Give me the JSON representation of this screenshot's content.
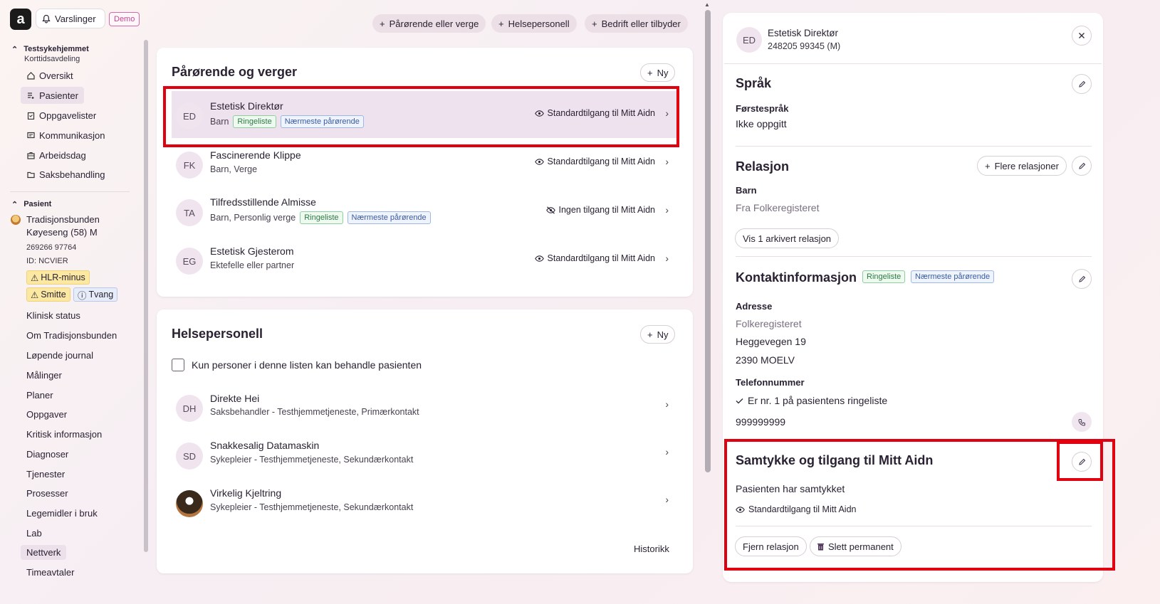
{
  "header": {
    "logo": "a",
    "notifications_label": "Varslinger",
    "demo_badge": "Demo"
  },
  "sidebar": {
    "unit_name": "Testsykehjemmet",
    "unit_sub": "Korttidsavdeling",
    "unit_items": [
      {
        "label": "Oversikt",
        "icon": "home-icon"
      },
      {
        "label": "Pasienter",
        "icon": "patients-icon"
      },
      {
        "label": "Oppgavelister",
        "icon": "clipboard-icon"
      },
      {
        "label": "Kommunikasjon",
        "icon": "message-icon"
      },
      {
        "label": "Arbeidsdag",
        "icon": "briefcase-icon"
      },
      {
        "label": "Saksbehandling",
        "icon": "folder-icon"
      }
    ],
    "patient_section": "Pasient",
    "patient_name": "Tradisjonsbunden Køyeseng (58) M",
    "patient_number": "269266 97764",
    "patient_id": "ID: NCVIER",
    "badges": {
      "hlr": "HLR-minus",
      "smitte": "Smitte",
      "tvang": "Tvang"
    },
    "patient_items": [
      "Klinisk status",
      "Om Tradisjonsbunden",
      "Løpende journal",
      "Målinger",
      "Planer",
      "Oppgaver",
      "Kritisk informasjon",
      "Diagnoser",
      "Tjenester",
      "Prosesser",
      "Legemidler i bruk",
      "Lab",
      "Nettverk",
      "Timeavtaler"
    ]
  },
  "actions": {
    "add_relative": "Pårørende eller verge",
    "add_health": "Helsepersonell",
    "add_company": "Bedrift eller tilbyder"
  },
  "relatives": {
    "title": "Pårørende og verger",
    "new_label": "Ny",
    "rows": [
      {
        "initials": "ED",
        "name": "Estetisk Direktør",
        "relation": "Barn",
        "tags": [
          "Ringeliste",
          "Nærmeste pårørende"
        ],
        "access": "Standardtilgang til Mitt Aidn"
      },
      {
        "initials": "FK",
        "name": "Fascinerende Klippe",
        "relation": "Barn, Verge",
        "tags": [],
        "access": "Standardtilgang til Mitt Aidn"
      },
      {
        "initials": "TA",
        "name": "Tilfredsstillende Almisse",
        "relation": "Barn, Personlig verge",
        "tags": [
          "Ringeliste",
          "Nærmeste pårørende"
        ],
        "access": "Ingen tilgang til Mitt Aidn"
      },
      {
        "initials": "EG",
        "name": "Estetisk Gjesterom",
        "relation": "Ektefelle eller partner",
        "tags": [],
        "access": "Standardtilgang til Mitt Aidn"
      }
    ]
  },
  "health": {
    "title": "Helsepersonell",
    "new_label": "Ny",
    "checkbox_label": "Kun personer i denne listen kan behandle pasienten",
    "rows": [
      {
        "initials": "DH",
        "name": "Direkte Hei",
        "role": "Saksbehandler - Testhjemmetjeneste, Primærkontakt"
      },
      {
        "initials": "SD",
        "name": "Snakkesalig Datamaskin",
        "role": "Sykepleier - Testhjemmetjeneste, Sekundærkontakt"
      },
      {
        "initials": "",
        "name": "Virkelig Kjeltring",
        "role": "Sykepleier - Testhjemmetjeneste, Sekundærkontakt"
      }
    ],
    "history_link": "Historikk"
  },
  "detail": {
    "initials": "ED",
    "name": "Estetisk Direktør",
    "id": "248205 99345 (M)",
    "language": {
      "title": "Språk",
      "label": "Førstespråk",
      "value": "Ikke oppgitt"
    },
    "relation": {
      "title": "Relasjon",
      "more_button": "Flere relasjoner",
      "type": "Barn",
      "source": "Fra Folkeregisteret",
      "archived_button": "Vis 1 arkivert relasjon"
    },
    "contact": {
      "title": "Kontaktinformasjon",
      "tags": [
        "Ringeliste",
        "Nærmeste pårørende"
      ],
      "address_label": "Adresse",
      "address_source": "Folkeregisteret",
      "street": "Heggevegen 19",
      "postal": "2390 MOELV",
      "phone_label": "Telefonnummer",
      "ringlist_note": "Er nr. 1 på pasientens ringeliste",
      "phone": "999999999"
    },
    "consent": {
      "title": "Samtykke og tilgang til Mitt Aidn",
      "status": "Pasienten har samtykket",
      "access": "Standardtilgang til Mitt Aidn",
      "remove_button": "Fjern relasjon",
      "delete_button": "Slett permanent"
    }
  },
  "colors": {
    "accent": "#ece0ea",
    "highlight": "#e00010",
    "selected_row": "#efe2ef"
  }
}
